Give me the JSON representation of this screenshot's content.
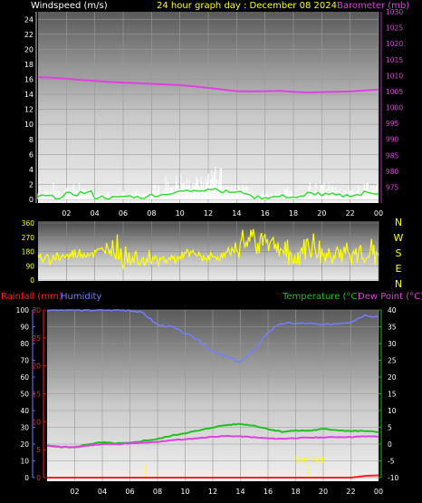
{
  "header": {
    "windspeed_label": "Windspeed (m/s)",
    "title": "24 hour graph day : December 08 2024",
    "barometer_label": "Barometer (mb)"
  },
  "bottom_header": {
    "rainfall_label": "Rainfall (mm)",
    "humidity_label": "Humidity",
    "temperature_label": "Temperature (°C)",
    "dewpoint_label": "Dew Point (°C)"
  },
  "annotations": {
    "sunset_label": "Sun Set"
  },
  "colors": {
    "windspeed": "#ffffff",
    "wind_avg": "#33dd33",
    "barometer": "#e040e0",
    "direction": "#ffff00",
    "title": "#ffff00",
    "rainfall": "#ff2020",
    "humidity": "#7080ff",
    "temperature": "#20c020",
    "dewpoint": "#e040e0",
    "left_axis_wind": "#ffffff",
    "sunrise_marker": "#ffff00"
  },
  "chart_data": [
    {
      "type": "line",
      "name": "wind-barometer",
      "x_tick_labels": [
        "02",
        "04",
        "06",
        "08",
        "10",
        "12",
        "14",
        "16",
        "18",
        "20",
        "22",
        "00"
      ],
      "left_axis": {
        "label": "Windspeed (m/s)",
        "ylim": [
          0,
          25
        ],
        "ticks": [
          0,
          2,
          4,
          6,
          8,
          10,
          12,
          14,
          16,
          18,
          20,
          22,
          24
        ]
      },
      "right_axis": {
        "label": "Barometer (mb)",
        "ylim": [
          970,
          1030
        ],
        "ticks": [
          975,
          980,
          985,
          990,
          995,
          1000,
          1005,
          1010,
          1015,
          1020,
          1025,
          1030
        ]
      },
      "series": [
        {
          "name": "Barometer",
          "axis": "right",
          "x": [
            0,
            1,
            2,
            3,
            4,
            5,
            6,
            7,
            8,
            9,
            10,
            11,
            12,
            13,
            14,
            15,
            16,
            17,
            18,
            19,
            20,
            21,
            22,
            23,
            24
          ],
          "values": [
            1009.5,
            1009.3,
            1009.0,
            1008.6,
            1008.3,
            1008.0,
            1007.8,
            1007.6,
            1007.4,
            1007.2,
            1007.0,
            1006.6,
            1006.1,
            1005.6,
            1005.1,
            1005.0,
            1005.1,
            1005.2,
            1004.9,
            1004.7,
            1004.8,
            1004.9,
            1005.0,
            1005.3,
            1005.6
          ]
        }
      ],
      "wind_hourly_avg": [
        0.4,
        0.3,
        0.7,
        0.9,
        0.3,
        0.2,
        0.4,
        0.3,
        0.6,
        0.8,
        1.1,
        1.3,
        1.4,
        1.0,
        0.9,
        0.3,
        0.3,
        0.4,
        0.3,
        0.8,
        0.6,
        0.5,
        0.6,
        0.9
      ],
      "wind_hourly_gust": [
        1.6,
        2.3,
        2.8,
        1.9,
        1.2,
        1.0,
        1.7,
        1.3,
        2.6,
        3.5,
        3.9,
        4.1,
        6.5,
        2.4,
        2.6,
        1.6,
        1.2,
        1.7,
        1.0,
        2.9,
        2.8,
        1.7,
        2.4,
        3.0
      ]
    },
    {
      "type": "line",
      "name": "wind-direction",
      "x_tick_labels": [
        "02",
        "04",
        "06",
        "08",
        "10",
        "12",
        "14",
        "16",
        "18",
        "20",
        "22",
        "00"
      ],
      "left_axis": {
        "ylim": [
          0,
          360
        ],
        "ticks": [
          0,
          90,
          180,
          270,
          360
        ]
      },
      "right_axis": {
        "labels": [
          "N",
          "W",
          "S",
          "E",
          "N"
        ]
      },
      "series": [
        {
          "name": "Direction",
          "x": [
            0,
            1,
            2,
            3,
            4,
            5,
            6,
            7,
            8,
            9,
            10,
            11,
            12,
            13,
            14,
            15,
            16,
            17,
            18,
            19,
            20,
            21,
            22,
            23,
            24
          ],
          "values": [
            135,
            140,
            150,
            160,
            170,
            210,
            160,
            150,
            140,
            120,
            150,
            160,
            140,
            150,
            200,
            260,
            270,
            200,
            120,
            230,
            150,
            180,
            140,
            160,
            170
          ]
        }
      ]
    },
    {
      "type": "line",
      "name": "temperature-humidity",
      "x_tick_labels": [
        "02",
        "04",
        "06",
        "08",
        "10",
        "12",
        "14",
        "16",
        "18",
        "20",
        "22",
        "00"
      ],
      "left_axis_humidity": {
        "label": "Humidity",
        "ylim": [
          0,
          100
        ],
        "ticks": [
          0,
          10,
          20,
          30,
          40,
          50,
          60,
          70,
          80,
          90,
          100
        ]
      },
      "left_axis_rain": {
        "label": "Rainfall (mm)",
        "ylim": [
          0,
          30
        ],
        "ticks": [
          0,
          5,
          10,
          15,
          20,
          25,
          30
        ]
      },
      "right_axis": {
        "label": "Temperature (°C)",
        "ylim": [
          -10,
          40
        ],
        "ticks": [
          -10,
          -5,
          0,
          5,
          10,
          15,
          20,
          25,
          30,
          35,
          40
        ]
      },
      "series": [
        {
          "name": "Humidity",
          "axis": "humidity",
          "x": [
            0,
            1,
            2,
            3,
            4,
            5,
            6,
            7,
            8,
            9,
            10,
            11,
            12,
            13,
            14,
            15,
            16,
            17,
            18,
            19,
            20,
            21,
            22,
            23,
            24
          ],
          "values": [
            100,
            100,
            100,
            100,
            100,
            100,
            100,
            98,
            91,
            90,
            86,
            82,
            75,
            72,
            69,
            76,
            87,
            92,
            92,
            92,
            91,
            92,
            93,
            97,
            96
          ]
        },
        {
          "name": "Temperature",
          "axis": "temp",
          "x": [
            0,
            1,
            2,
            3,
            4,
            5,
            6,
            7,
            8,
            9,
            10,
            11,
            12,
            13,
            14,
            15,
            16,
            17,
            18,
            19,
            20,
            21,
            22,
            23,
            24
          ],
          "values": [
            -0.5,
            -0.8,
            -1.0,
            0.0,
            0.5,
            0.2,
            0.3,
            1.0,
            1.5,
            2.5,
            3.3,
            4.0,
            5.0,
            5.7,
            6.0,
            5.5,
            4.5,
            3.7,
            4.0,
            4.0,
            4.5,
            4.2,
            3.9,
            3.9,
            3.6
          ]
        },
        {
          "name": "Dew Point",
          "axis": "temp",
          "x": [
            0,
            1,
            2,
            3,
            4,
            5,
            6,
            7,
            8,
            9,
            10,
            11,
            12,
            13,
            14,
            15,
            16,
            17,
            18,
            19,
            20,
            21,
            22,
            23,
            24
          ],
          "values": [
            -0.5,
            -0.8,
            -1.0,
            -0.4,
            0.0,
            0.0,
            0.2,
            0.4,
            0.6,
            1.2,
            1.4,
            1.8,
            2.2,
            2.4,
            2.3,
            2.0,
            1.7,
            1.6,
            1.8,
            1.9,
            2.0,
            2.1,
            2.1,
            2.3,
            2.3
          ]
        },
        {
          "name": "Rainfall",
          "axis": "rain",
          "x": [
            0,
            1,
            2,
            3,
            4,
            5,
            6,
            7,
            8,
            9,
            10,
            11,
            12,
            13,
            14,
            15,
            16,
            17,
            18,
            19,
            20,
            21,
            22,
            23,
            24
          ],
          "values": [
            0,
            0,
            0,
            0,
            0,
            0,
            0,
            0,
            0,
            0,
            0,
            0,
            0,
            0,
            0,
            0,
            0,
            0,
            0,
            0,
            0,
            0,
            0,
            0.3,
            0.4
          ]
        }
      ],
      "markers": [
        {
          "label": "",
          "x": 7.1
        },
        {
          "label": "Sun Set",
          "x": 18.9
        }
      ]
    }
  ]
}
